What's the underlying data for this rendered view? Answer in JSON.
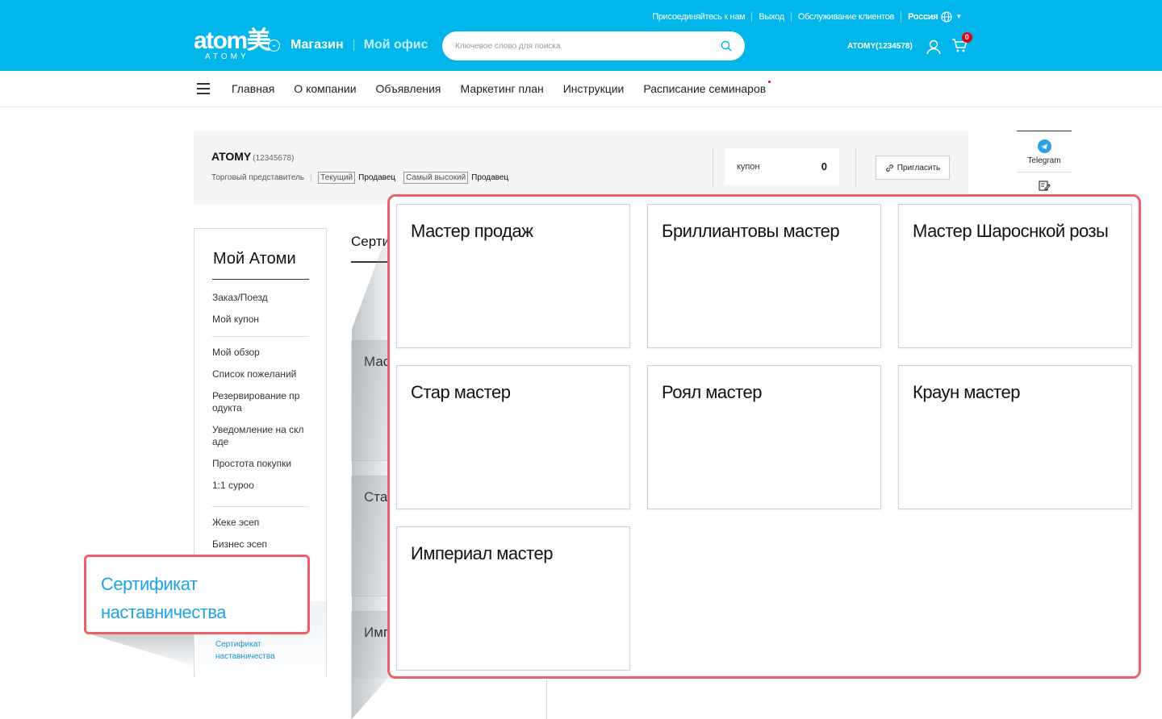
{
  "header": {
    "top_links": [
      "Присоединяйтесь к нам",
      "Выход",
      "Обслуживание клиентов"
    ],
    "country": "Россия",
    "logo_word": "atom美",
    "logo_sub": "ATOMY",
    "nav_shop": "Магазин",
    "nav_office": "Мой офис",
    "search_placeholder": "Ключевое слово для поиска",
    "username": "ATOMY(1234578)",
    "cart_count": "0",
    "brand_color": "#00b6ea"
  },
  "gnb": {
    "items": [
      "Главная",
      "О компании",
      "Объявления",
      "Маркетинг план",
      "Инструкции",
      "Расписание семинаров"
    ]
  },
  "profile": {
    "name": "ATOMY",
    "id": "(12345678)",
    "role": "Торговый представитель",
    "current_tag": "Текущий",
    "current_val": "Продавец",
    "highest_tag": "Самый высокий",
    "highest_val": "Продавец",
    "coupon_label": "купон",
    "coupon_value": "0",
    "invite_label": "Пригласить"
  },
  "rightbar": {
    "telegram": "Telegram"
  },
  "sidebar": {
    "title": "Мой Атоми",
    "group1": [
      "Заказ/Поезд",
      "Мой купон"
    ],
    "group2": [
      "Мой обзор",
      "Список пожеланий",
      "Резервирование пр одукта",
      "Уведомление на скл аде",
      "Простота покупки",
      "1:1 сурoo"
    ],
    "group3": [
      "Жеке эсеп",
      "Бизнес эсеп"
    ],
    "active": "Сертификат наставничества"
  },
  "content": {
    "title": "Серти",
    "blocks": [
      "Мас",
      "Ста",
      "Имп"
    ]
  },
  "zoom": {
    "cards": [
      "Мастер продаж",
      "Бриллиантовы мастер",
      "Мастер Шароснкой розы",
      "Стар мастер",
      "Роял мастер",
      "Краун мастер",
      "Империал мастер"
    ],
    "cert_label": "Сертификат наставничества",
    "highlight_color": "#ee6069"
  }
}
